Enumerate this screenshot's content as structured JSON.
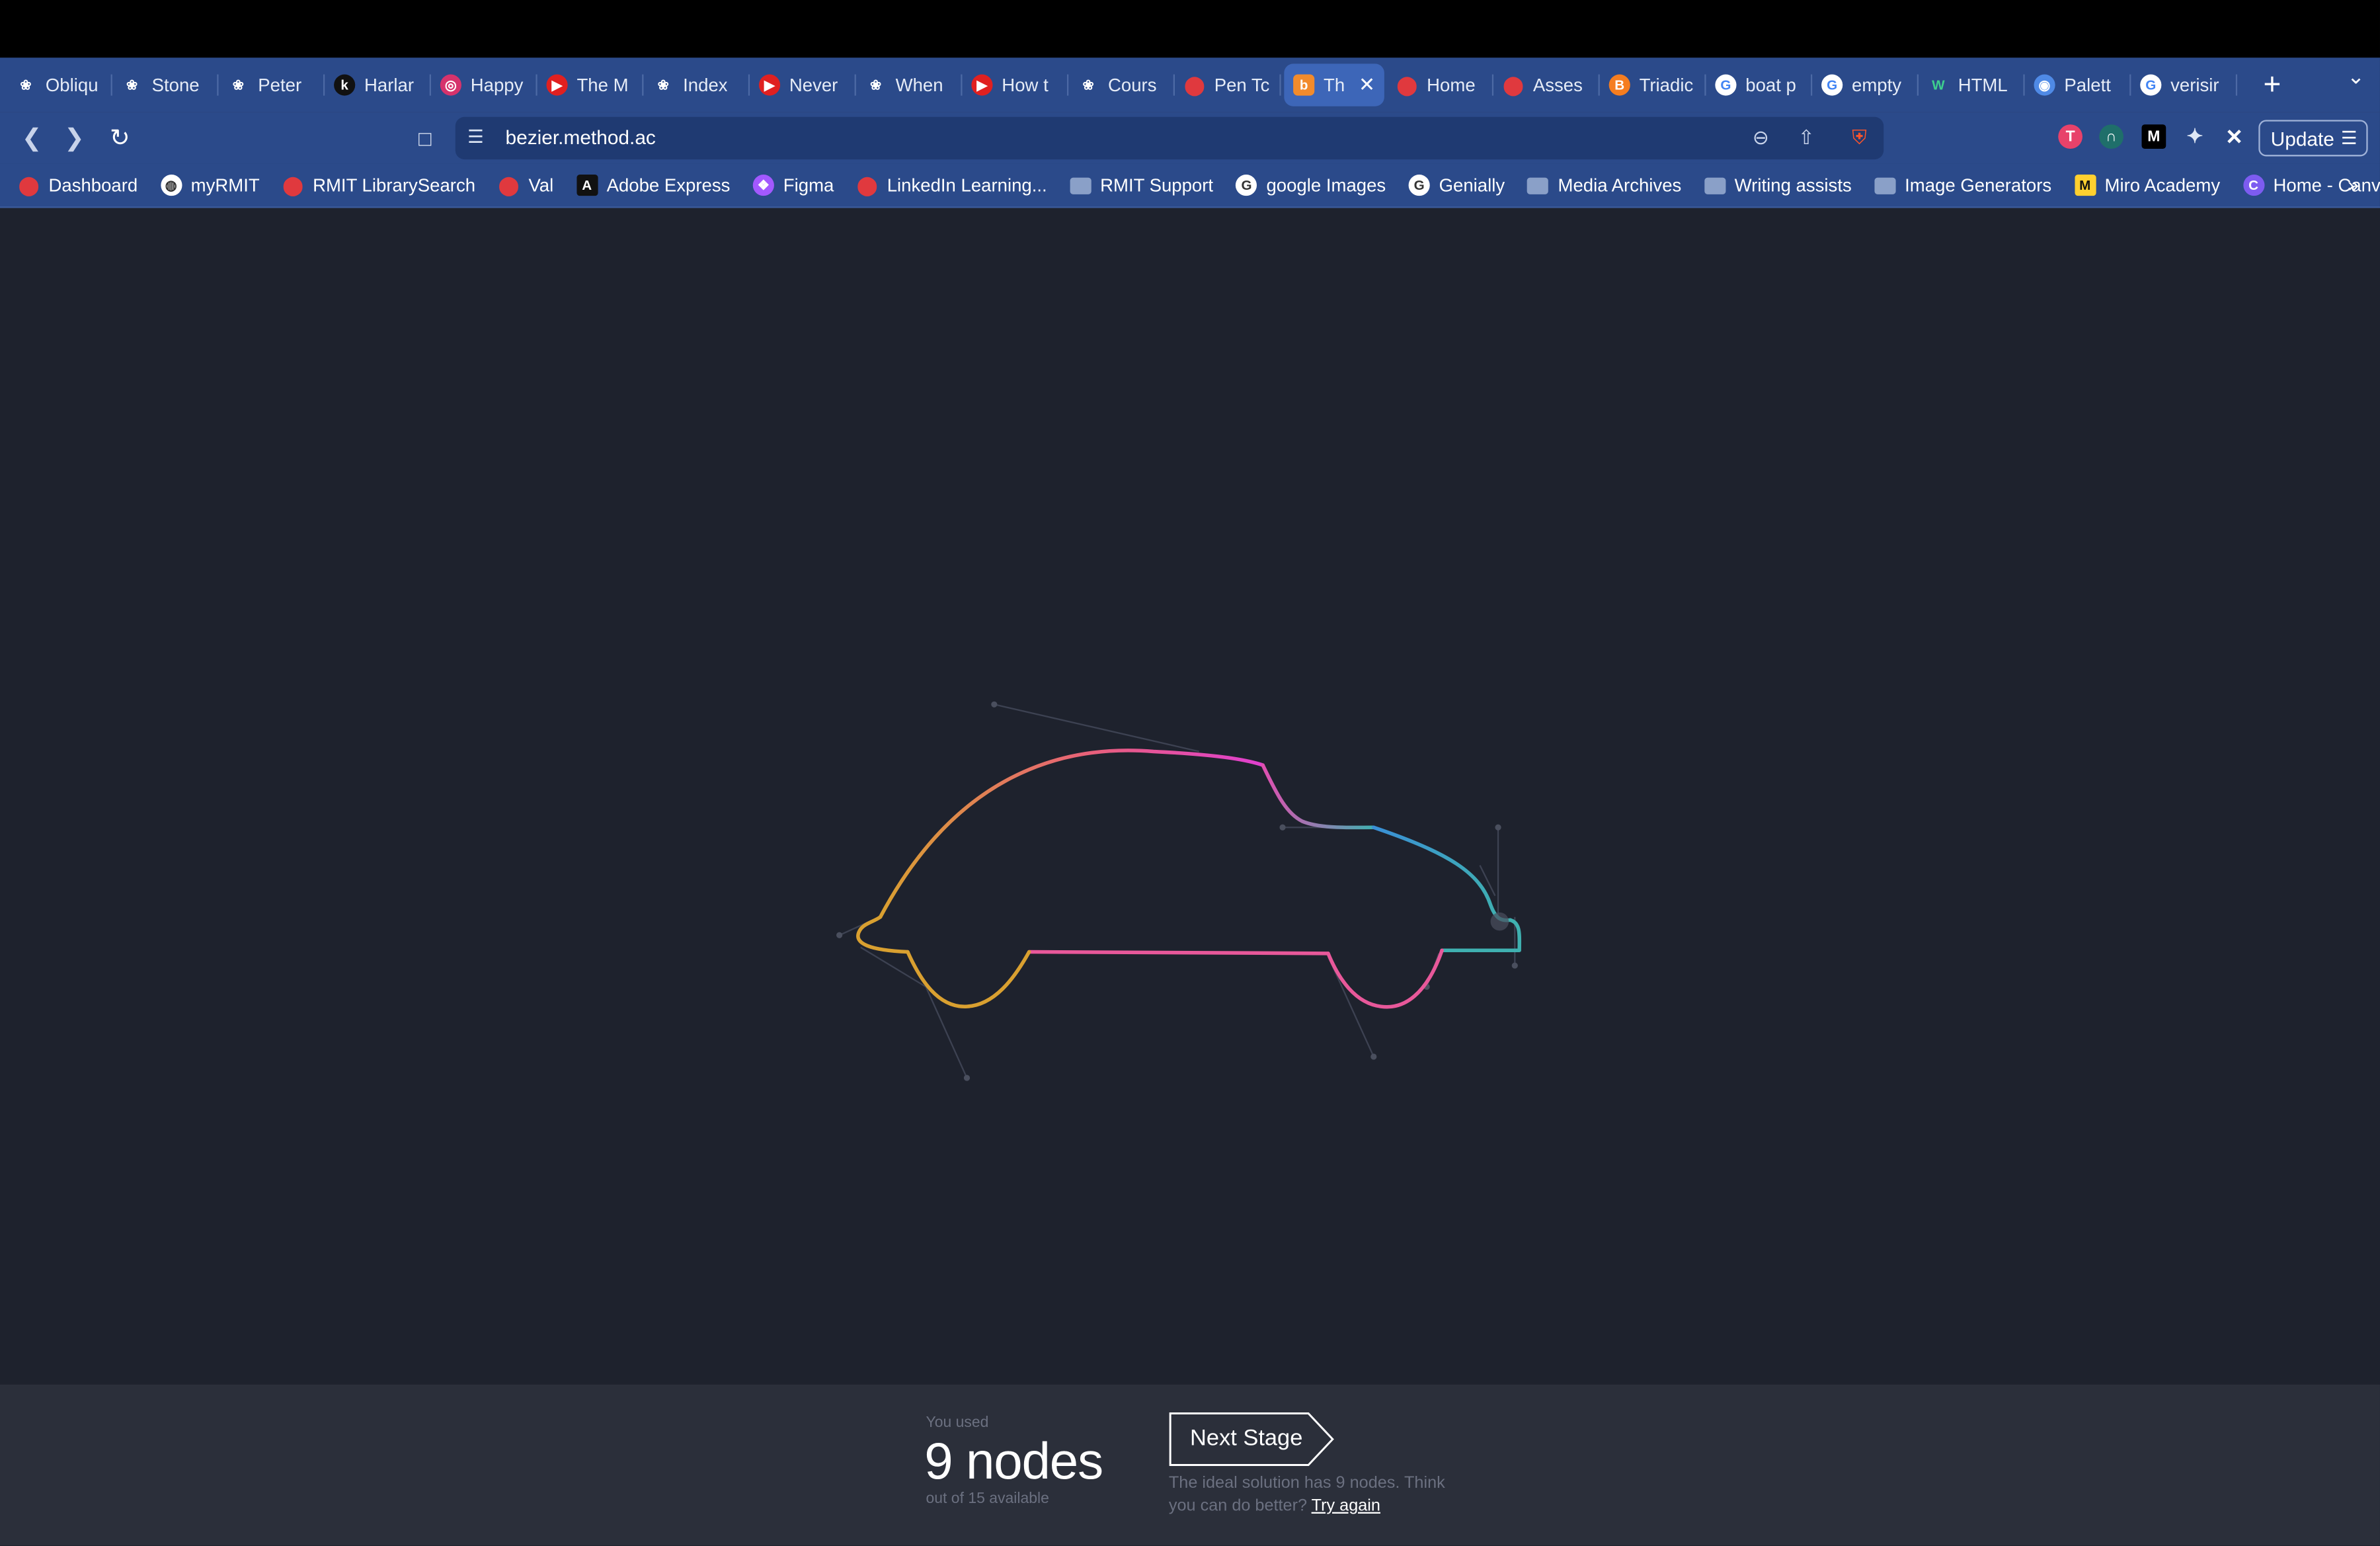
{
  "tabs": [
    {
      "title": "Obliqu",
      "icon": "openai-icon",
      "color": "#2b4a8a"
    },
    {
      "title": "Stone",
      "icon": "openai-icon",
      "color": "#2b4a8a"
    },
    {
      "title": "Peter",
      "icon": "openai-icon",
      "color": "#2b4a8a"
    },
    {
      "title": "Harlar",
      "icon": "k-icon",
      "color": "#111111"
    },
    {
      "title": "Happy",
      "icon": "instagram-icon",
      "color": "#d6336c"
    },
    {
      "title": "The M",
      "icon": "youtube-icon",
      "color": "#e02020"
    },
    {
      "title": "Index",
      "icon": "openai-icon",
      "color": "#2b4a8a"
    },
    {
      "title": "Never",
      "icon": "youtube-icon",
      "color": "#e02020"
    },
    {
      "title": "When",
      "icon": "openai-icon",
      "color": "#2b4a8a"
    },
    {
      "title": "How t",
      "icon": "youtube-icon",
      "color": "#e02020"
    },
    {
      "title": "Cours",
      "icon": "openai-icon",
      "color": "#2b4a8a"
    },
    {
      "title": "Pen Tc",
      "icon": "rmit-icon",
      "color": "#e0393e"
    },
    {
      "title": "Th",
      "icon": "bezier-icon",
      "color": "#f28b2c",
      "active": true
    },
    {
      "title": "Home",
      "icon": "rmit-icon",
      "color": "#e0393e"
    },
    {
      "title": "Asses",
      "icon": "rmit-icon",
      "color": "#e0393e"
    },
    {
      "title": "Triadic",
      "icon": "blogger-icon",
      "color": "#f57d20"
    },
    {
      "title": "boat p",
      "icon": "google-icon",
      "color": "#ffffff"
    },
    {
      "title": "empty",
      "icon": "google-icon",
      "color": "#ffffff"
    },
    {
      "title": "HTML",
      "icon": "w-icon",
      "color": "#2b4a8a"
    },
    {
      "title": "Palett",
      "icon": "chrome-icon",
      "color": "#4f8ae6"
    },
    {
      "title": "verisir",
      "icon": "google-icon",
      "color": "#ffffff"
    }
  ],
  "url": "bezier.method.ac",
  "update_label": "Update",
  "bookmarks": [
    {
      "label": "Dashboard",
      "icon": "rmit-icon",
      "color": "#e0393e"
    },
    {
      "label": "myRMIT",
      "icon": "globe-icon",
      "color": "#ffffff"
    },
    {
      "label": "RMIT LibrarySearch",
      "icon": "rmit-icon",
      "color": "#e0393e"
    },
    {
      "label": "Val",
      "icon": "rmit-icon",
      "color": "#e0393e"
    },
    {
      "label": "Adobe Express",
      "icon": "adobe-icon",
      "color": "#111111"
    },
    {
      "label": "Figma",
      "icon": "figma-icon",
      "color": "#a259ff"
    },
    {
      "label": "LinkedIn Learning...",
      "icon": "rmit-icon",
      "color": "#e0393e"
    },
    {
      "label": "RMIT Support",
      "icon": "folder-icon",
      "color": "#8aa0c8"
    },
    {
      "label": "google Images",
      "icon": "google-icon",
      "color": "#ffffff"
    },
    {
      "label": "Genially",
      "icon": "genially-icon",
      "color": "#ffffff"
    },
    {
      "label": "Media Archives",
      "icon": "folder-icon",
      "color": "#8aa0c8"
    },
    {
      "label": "Writing assists",
      "icon": "folder-icon",
      "color": "#8aa0c8"
    },
    {
      "label": "Image Generators",
      "icon": "folder-icon",
      "color": "#8aa0c8"
    },
    {
      "label": "Miro Academy",
      "icon": "miro-icon",
      "color": "#ffd02f"
    },
    {
      "label": "Home - Canva",
      "icon": "canva-icon",
      "color": "#7d5cf0"
    }
  ],
  "colors": {
    "curve_orange": "#d9a030",
    "curve_pink": "#e8589a",
    "curve_teal": "#3fb0b0",
    "curve_blue": "#3a8fd6"
  },
  "footer": {
    "used_label": "You used",
    "node_count": "9 nodes",
    "available": "out of 15 available",
    "next_stage_label": "Next Stage",
    "ideal_text": "The ideal solution has 9 nodes. Think you can do better?",
    "try_again": "Try again"
  }
}
